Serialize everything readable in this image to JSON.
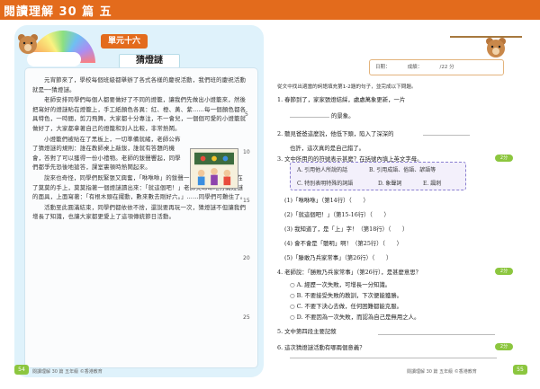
{
  "header": {
    "title": "閱讀理解 30 篇 五"
  },
  "left": {
    "badge": "單元十六",
    "lesson_title": "猜燈謎",
    "paragraphs": [
      "元宵節來了，學校每個班級都舉辦了各式各樣的慶祝活動，我們班的慶祝活動就是──猜燈謎。",
      "老師安排同學們每個人都要做好了不同的燈籠，讓我們先做出小燈籠來，然後把寫好的燈謎貼在燈籠上，手工紙顏色各異：紅、橙、黃、紫……每一個顏色都各具特色，一時間，剪刀飛舞，大家都十分專注，不一會兒，一個個可愛的小燈籠就做好了，大家都拿著自己的燈籠和別人比較，非常熱鬧。",
      "小燈籠們被貼在了黑板上，一切準備就緒，老師公佈了猜燈謎的規則：誰在教師桌上敲鈸，誰就有答題的機會，答對了可以獲得一份小禮物。老師的鈸聲響起，同學們都爭先恐後地搶答，課室裏頓時熱鬧起來。",
      "說來也奇怪，同學們既緊張又興奮，「咻咻咻」的鈸聲一陣一陣響起，球落在了莫莫的手上，莫莫指著一個燈謎讀出來：「就這個吧！」老師笑眯眯地打開燈謎的面具，上面寫著：「有根木頭在擺動，數來數去剛好六。」……同學們可難住了。",
      "活動至此圓滿結束，同學們都依依不捨，還說要再玩一次，猜燈謎不但讓我們增長了知識，也讓大家都更愛上了這項傳統節日活動。"
    ],
    "line_numbers": [
      "5",
      "10",
      "15",
      "20",
      "25"
    ]
  },
  "right": {
    "score_label": "日期：　　　　成績：　　　　/22 分",
    "instruction": "從文中找出適當的詞語填充第1-2題的句子，並完成以下問題。",
    "questions": [
      "1. 春節到了，家家張燈結綵，處處萬象更新，一片",
      "的景象。",
      "2. 聽見爸爸這麼說，他低下頭，陷入了深深的",
      "也許，這次真的是自己錯了。",
      "3. 文中所用的的符號表示甚麼？在括號內填上英文字母。",
      "(1)「咻咻咻」（第14行）（　　）",
      "(2)「就這個吧！」（第15-16行）（　　）",
      "(3) 我知道了，是「上」字！（第18行）（　　）",
      "(4) 會不會是「聽明」啊！（第25行）（　　）",
      "(5)「滕敢乃兵家常事」（第26行）（　　）",
      "4. 老師說：「勝敗乃兵家常事」（第26行），是甚麼意思？",
      "○ A. 經歷一次失敗，可增長一分知識。",
      "○ B. 不要接受失敗的教訓，下次便能獲勝。",
      "○ C. 不要下決心去做，任何困難都能克服。",
      "○ D. 不要因為一次失敗，而認為自己是無用之人。",
      "5. 文中第四段主要記敘",
      "6. 這次猜燈謎活動有哪兩個意義？"
    ],
    "choices": [
      "A. 引用他人所說的話",
      "B. 引用成語、俗語、諺語等",
      "C. 特別表明特殊的詞語",
      "D. 象聲詞",
      "E. 諷刺"
    ],
    "pill_label": "2分"
  },
  "footer": {
    "left_text": "閱讀理解 30 篇 五年級 ©香港教育",
    "right_text": "閱讀理解 30 篇 五年級 ©香港教育",
    "left_page": "54",
    "right_page": "55"
  },
  "colors": {
    "accent": "#e36b1c",
    "panel": "#dff2fb",
    "green": "#8cc63f"
  }
}
